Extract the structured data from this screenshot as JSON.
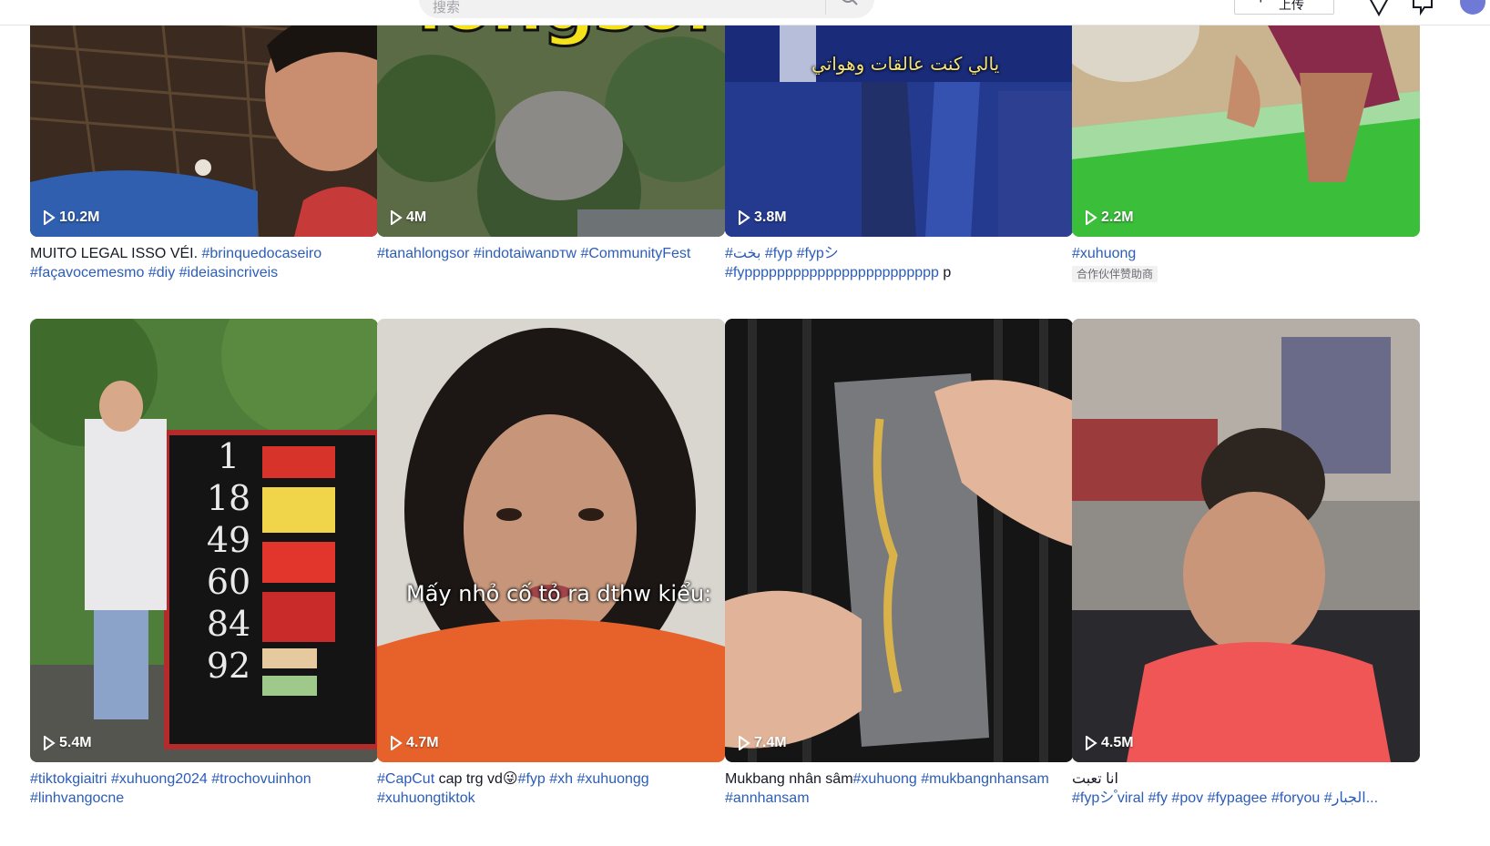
{
  "header": {
    "search_placeholder": "搜索",
    "upload_label": "上传",
    "icons": [
      "search-icon",
      "send-icon",
      "inbox-icon",
      "user-avatar"
    ]
  },
  "colors": {
    "hashtag": "#2b5db9",
    "text": "#161823",
    "badge_bg": "#f1f1f2"
  },
  "videos": [
    {
      "views": "10.2M",
      "caption_line1": [
        {
          "t": "MUITO LEGAL ISSO VÉI. ",
          "tag": false
        },
        {
          "t": "#brinquedocaseiro",
          "tag": true
        }
      ],
      "caption_line2": [
        {
          "t": "#façavocemesmo",
          "tag": true
        },
        {
          "t": " ",
          "tag": false
        },
        {
          "t": "#diy",
          "tag": true
        },
        {
          "t": " ",
          "tag": false
        },
        {
          "t": "#ideiasincriveis",
          "tag": true
        }
      ],
      "badge": ""
    },
    {
      "views": "4M",
      "overlay": "longsor",
      "caption_line1": [
        {
          "t": "#tanahlongsor",
          "tag": true
        },
        {
          "t": " ",
          "tag": false
        },
        {
          "t": "#indotaiwan",
          "tag": true
        },
        {
          "t": "ᴅᴛᴡ",
          "tag": true
        },
        {
          "t": " ",
          "tag": false
        },
        {
          "t": "#CommunityFest",
          "tag": true
        }
      ],
      "caption_line2": [],
      "badge": ""
    },
    {
      "views": "3.8M",
      "overlay": "يالي كنت عالقات وهواتي",
      "caption_line1": [
        {
          "t": "#بخت",
          "tag": true
        },
        {
          "t": " ",
          "tag": false
        },
        {
          "t": "#fyp",
          "tag": true
        },
        {
          "t": " ",
          "tag": false
        },
        {
          "t": "#fypシ",
          "tag": true
        }
      ],
      "caption_line2": [
        {
          "t": "#fypppppppppppppppppppppppp",
          "tag": true
        },
        {
          "t": " p",
          "tag": false
        }
      ],
      "badge": ""
    },
    {
      "views": "2.2M",
      "caption_line1": [
        {
          "t": "#xuhuong",
          "tag": true
        }
      ],
      "caption_line2": [],
      "badge": "合作伙伴赞助商"
    },
    {
      "views": "5.4M",
      "board_numbers": [
        "1",
        "18",
        "49",
        "60",
        "84",
        "92"
      ],
      "caption_line1": [
        {
          "t": "#tiktokgiaitri",
          "tag": true
        },
        {
          "t": " ",
          "tag": false
        },
        {
          "t": "#xuhuong2024",
          "tag": true
        },
        {
          "t": " ",
          "tag": false
        },
        {
          "t": "#trochovuinhon",
          "tag": true
        }
      ],
      "caption_line2": [
        {
          "t": "#linhvangocne",
          "tag": true
        }
      ],
      "badge": ""
    },
    {
      "views": "4.7M",
      "overlay": "Mấy nhỏ cố tỏ ra dthw kiểu:",
      "caption_line1": [
        {
          "t": "#CapCut",
          "tag": true
        },
        {
          "t": " cap trg vd😜",
          "tag": false
        },
        {
          "t": "#fyp",
          "tag": true
        },
        {
          "t": " ",
          "tag": false
        },
        {
          "t": "#xh",
          "tag": true
        },
        {
          "t": " ",
          "tag": false
        },
        {
          "t": "#xuhuongg",
          "tag": true
        }
      ],
      "caption_line2": [
        {
          "t": "#xuhuongtiktok",
          "tag": true
        }
      ],
      "badge": ""
    },
    {
      "views": "7.4M",
      "caption_line1": [
        {
          "t": "Mukbang nhân sâm",
          "tag": false
        },
        {
          "t": "#xuhuong",
          "tag": true
        },
        {
          "t": " ",
          "tag": false
        },
        {
          "t": "#mukbangnhansam",
          "tag": true
        }
      ],
      "caption_line2": [
        {
          "t": "#annhansam",
          "tag": true
        }
      ],
      "badge": ""
    },
    {
      "views": "4.5M",
      "caption_line1": [
        {
          "t": "انا تعبت",
          "tag": false
        }
      ],
      "caption_line2": [
        {
          "t": "#fypシ",
          "tag": true
        },
        {
          "t": " ゚viral",
          "tag": true
        },
        {
          "t": " ",
          "tag": false
        },
        {
          "t": "#fy",
          "tag": true
        },
        {
          "t": " ",
          "tag": false
        },
        {
          "t": "#pov",
          "tag": true
        },
        {
          "t": " ",
          "tag": false
        },
        {
          "t": "#fypagee",
          "tag": true
        },
        {
          "t": " ",
          "tag": false
        },
        {
          "t": "#foryou",
          "tag": true
        },
        {
          "t": " ",
          "tag": false
        },
        {
          "t": "#الجبار...",
          "tag": true
        }
      ],
      "badge": ""
    }
  ]
}
